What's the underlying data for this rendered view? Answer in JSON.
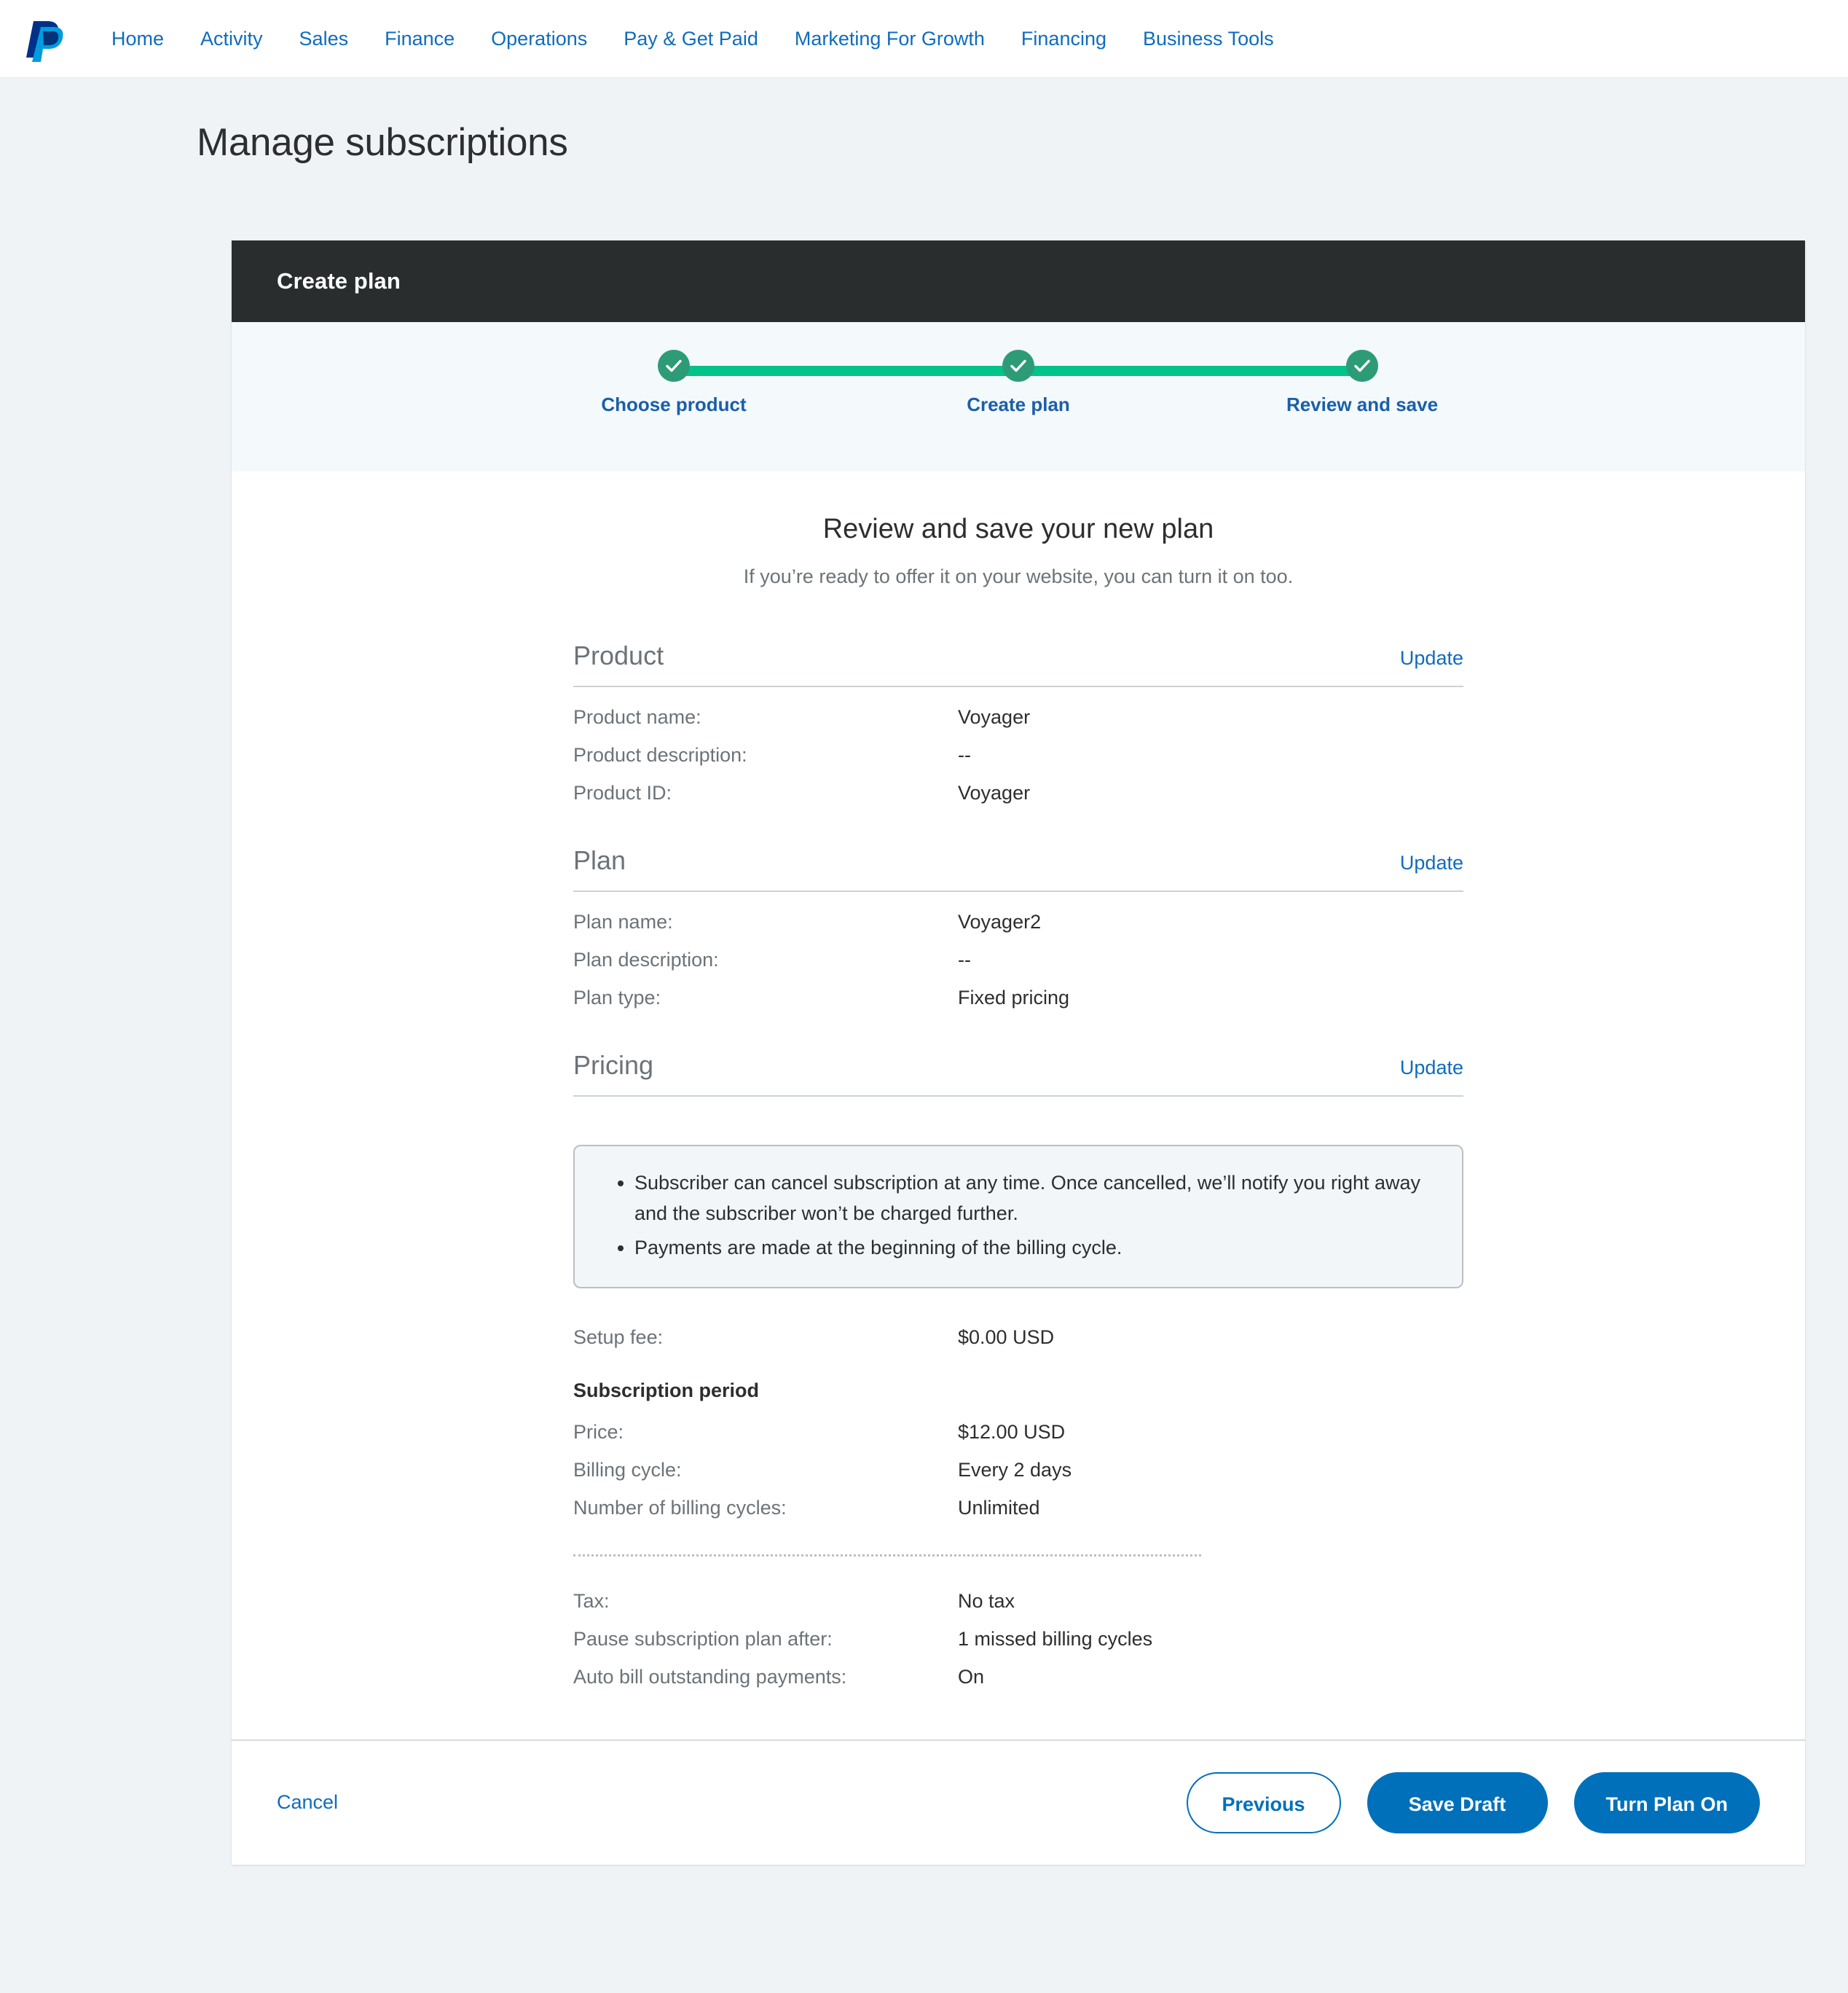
{
  "nav": {
    "logo_icon": "paypal-logo-icon",
    "links": [
      "Home",
      "Activity",
      "Sales",
      "Finance",
      "Operations",
      "Pay & Get Paid",
      "Marketing For Growth",
      "Financing",
      "Business Tools"
    ]
  },
  "page": {
    "title": "Manage subscriptions"
  },
  "card": {
    "header_title": "Create plan"
  },
  "stepper": {
    "steps": [
      {
        "label": "Choose product",
        "state": "complete",
        "icon": "check-icon"
      },
      {
        "label": "Create plan",
        "state": "complete",
        "icon": "check-icon"
      },
      {
        "label": "Review and save",
        "state": "complete",
        "icon": "check-icon"
      }
    ],
    "colors": {
      "dot": "#2d9c76",
      "track": "#00c389",
      "label": "#1a5fa8"
    }
  },
  "review": {
    "heading": "Review and save your new plan",
    "subheading": "If you’re ready to offer it on your website, you can turn it on too."
  },
  "sections": {
    "product": {
      "title": "Product",
      "update_label": "Update",
      "rows": [
        {
          "label": "Product name:",
          "value": "Voyager"
        },
        {
          "label": "Product description:",
          "value": "--"
        },
        {
          "label": "Product ID:",
          "value": "Voyager"
        }
      ]
    },
    "plan": {
      "title": "Plan",
      "update_label": "Update",
      "rows": [
        {
          "label": "Plan name:",
          "value": "Voyager2"
        },
        {
          "label": "Plan description:",
          "value": "--"
        },
        {
          "label": "Plan type:",
          "value": "Fixed pricing"
        }
      ]
    },
    "pricing": {
      "title": "Pricing",
      "update_label": "Update",
      "notes": [
        "Subscriber can cancel subscription at any time. Once cancelled, we’ll notify you right away and the subscriber won’t be charged further.",
        "Payments are made at the beginning of the billing cycle."
      ],
      "setup_fee": {
        "label": "Setup fee:",
        "value": "$0.00 USD"
      },
      "subscription_period_title": "Subscription period",
      "period_rows": [
        {
          "label": "Price:",
          "value": "$12.00 USD"
        },
        {
          "label": "Billing cycle:",
          "value": "Every 2 days"
        },
        {
          "label": "Number of billing cycles:",
          "value": "Unlimited"
        }
      ],
      "extra_rows": [
        {
          "label": "Tax:",
          "value": "No tax"
        },
        {
          "label": "Pause subscription plan after:",
          "value": "1 missed billing cycles"
        },
        {
          "label": "Auto bill outstanding payments:",
          "value": "On"
        }
      ]
    }
  },
  "footer": {
    "cancel_label": "Cancel",
    "previous_label": "Previous",
    "save_draft_label": "Save Draft",
    "turn_plan_on_label": "Turn Plan On"
  },
  "colors": {
    "brand_blue": "#0070ba",
    "link_blue": "#0f6cbd",
    "header_dark": "#2a2d2e",
    "page_bg": "#f0f3f6",
    "band_bg": "#f4f9fc"
  }
}
